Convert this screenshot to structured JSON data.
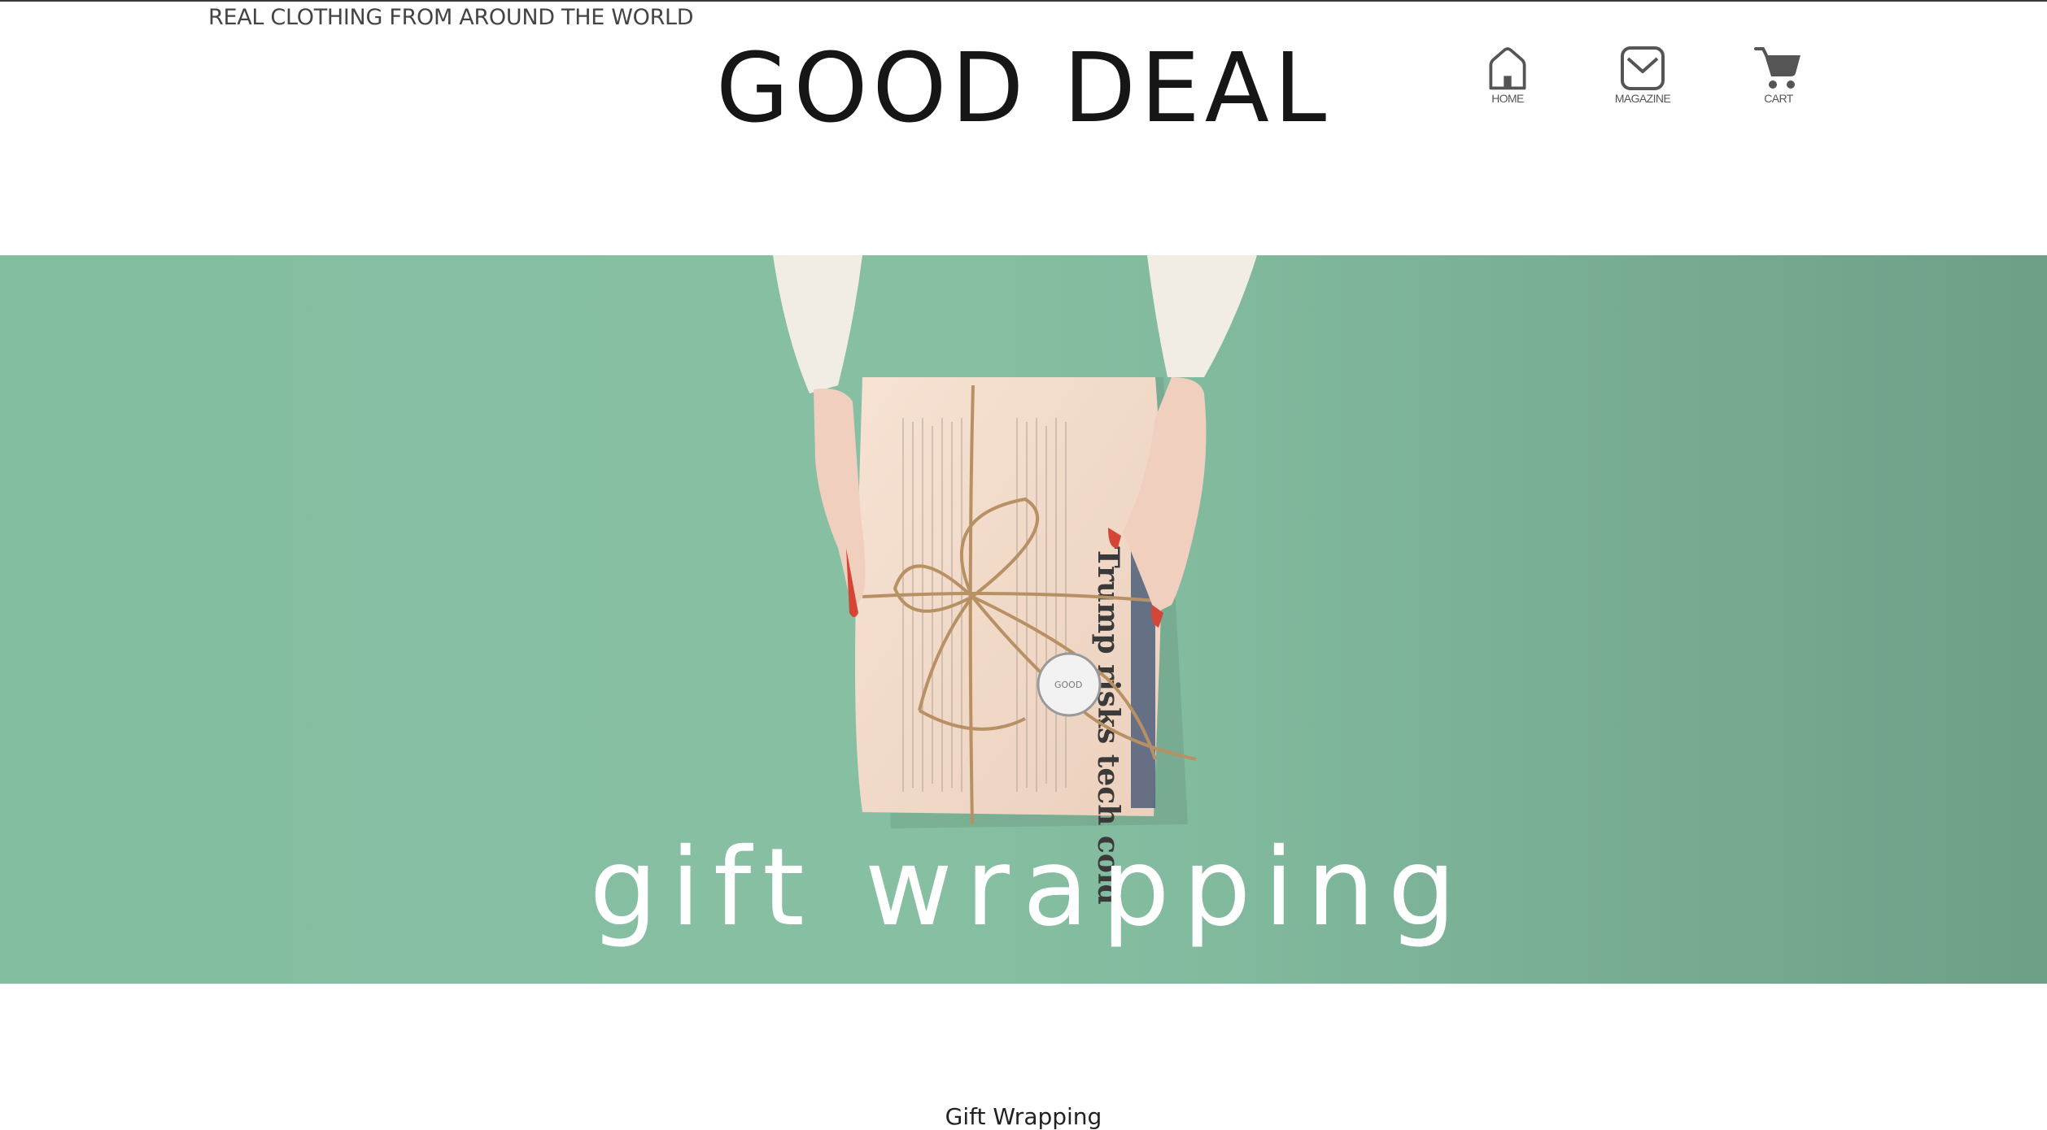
{
  "header": {
    "tagline": "REAL CLOTHING FROM AROUND THE WORLD",
    "logo": "GOOD DEAL"
  },
  "nav": [
    {
      "label": "HOME",
      "icon": "home-icon"
    },
    {
      "label": "MAGAZINE",
      "icon": "envelope-icon"
    },
    {
      "label": "CART",
      "icon": "cart-icon"
    }
  ],
  "hero": {
    "caption": "gift wrapping",
    "newspaper_headline": "Trump risks tech cold",
    "seal_text": "GOOD",
    "background_color": "#84bea1"
  },
  "section": {
    "heading": "Gift Wrapping"
  }
}
